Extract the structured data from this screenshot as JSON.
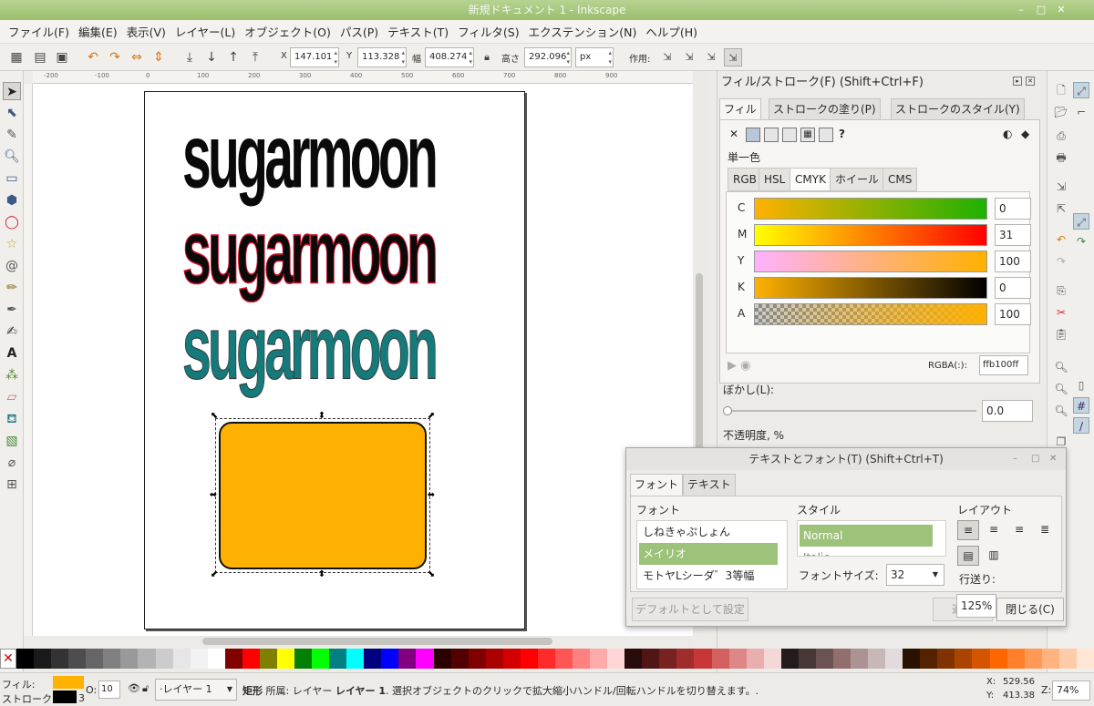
{
  "window": {
    "title": "新規ドキュメント 1 - Inkscape"
  },
  "menu": [
    "ファイル(F)",
    "編集(E)",
    "表示(V)",
    "レイヤー(L)",
    "オブジェクト(O)",
    "パス(P)",
    "テキスト(T)",
    "フィルタ(S)",
    "エクステンション(N)",
    "ヘルプ(H)"
  ],
  "controls": {
    "x_label": "X",
    "x_value": "147.101",
    "y_label": "Y",
    "y_value": "113.328",
    "w_label": "幅",
    "w_value": "408.274",
    "h_label": "高さ",
    "h_value": "292.096",
    "unit": "px",
    "affect_label": "作用:"
  },
  "ruler_ticks": [
    "-200",
    "-100",
    "0",
    "100",
    "200",
    "300",
    "400",
    "500",
    "600",
    "700",
    "800",
    "900"
  ],
  "canvas": {
    "text": "sugarmoon",
    "text_colors": [
      "#0a0a0a",
      "#0a0a0a",
      "#16797a"
    ],
    "rect_color": "#ffb100"
  },
  "fill_stroke": {
    "title": "フィル/ストローク(F) (Shift+Ctrl+F)",
    "tabs": [
      "フィル",
      "ストロークの塗り(P)",
      "ストロークのスタイル(Y)"
    ],
    "unknown_mark": "?",
    "flat_label": "単一色",
    "color_tabs": [
      "RGB",
      "HSL",
      "CMYK",
      "ホイール",
      "CMS"
    ],
    "channels": [
      {
        "label": "C",
        "value": "0"
      },
      {
        "label": "M",
        "value": "31"
      },
      {
        "label": "Y",
        "value": "100"
      },
      {
        "label": "K",
        "value": "0"
      },
      {
        "label": "A",
        "value": "100"
      }
    ],
    "rgba_label": "RGBA(:):",
    "rgba_value": "ffb100ff",
    "blur_label": "ぼかし(L):",
    "blur_value": "0.0",
    "opacity_label": "不透明度, %"
  },
  "text_dialog": {
    "title": "テキストとフォント(T) (Shift+Ctrl+T)",
    "tabs": [
      "フォント",
      "テキスト"
    ],
    "font_label": "フォント",
    "fonts": [
      "しねきゃぷしょん",
      "メイリオ",
      "モトヤLシーダ゛3等幅"
    ],
    "style_label": "スタイル",
    "styles": [
      "Normal",
      "Italic"
    ],
    "size_label": "フォントサイズ:",
    "size_value": "32",
    "layout_label": "レイアウト",
    "spacing_label": "行送り:",
    "spacing_value": "125%",
    "default_btn": "デフォルトとして設定",
    "apply_btn": "適用",
    "close_btn": "閉じる(C)"
  },
  "palette": [
    "#000000",
    "#1a1a1a",
    "#333333",
    "#4d4d4d",
    "#666666",
    "#808080",
    "#999999",
    "#b3b3b3",
    "#cccccc",
    "#e6e6e6",
    "#f2f2f2",
    "#ffffff",
    "#800000",
    "#ff0000",
    "#808000",
    "#ffff00",
    "#008000",
    "#00ff00",
    "#008080",
    "#00ffff",
    "#000080",
    "#0000ff",
    "#800080",
    "#ff00ff",
    "#2b0000",
    "#550000",
    "#800000",
    "#aa0000",
    "#d40000",
    "#ff0000",
    "#ff2a2a",
    "#ff5555",
    "#ff8080",
    "#ffaaaa",
    "#ffd5d5",
    "#280b0b",
    "#501616",
    "#782121",
    "#a02c2c",
    "#c83737",
    "#d35f5f",
    "#de8787",
    "#e9afaf",
    "#f4d7d7",
    "#241c1c",
    "#483737",
    "#6c5353",
    "#916f6f",
    "#ac9393",
    "#c8b7b7",
    "#e3dbdb",
    "#2b1100",
    "#552200",
    "#803300",
    "#aa4400",
    "#d45500",
    "#ff6600",
    "#ff7f2a",
    "#ff9955",
    "#ffb380",
    "#ffccaa",
    "#ffe6d5"
  ],
  "status": {
    "fill_label": "フィル:",
    "stroke_label": "ストローク:",
    "fill_color": "#ffb100",
    "stroke_color": "#000000",
    "stroke_width": "3",
    "opacity_label": "O:",
    "opacity_value": "10",
    "layer": "·レイヤー 1",
    "message_bold": "矩形",
    "message": " 所属: レイヤー ",
    "message_layer": "レイヤー 1",
    "message_tail": ". 選択オブジェクトのクリックで拡大縮小ハンドル/回転ハンドルを切り替えます。.",
    "cx_label": "X:",
    "cx": "529.56",
    "cy_label": "Y:",
    "cy": "413.38",
    "zoom_label": "Z:",
    "zoom": "74%"
  }
}
